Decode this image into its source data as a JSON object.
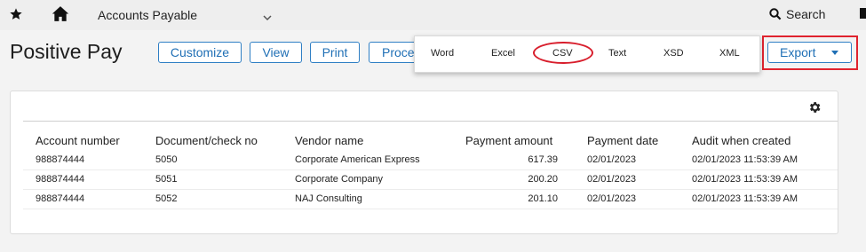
{
  "topbar": {
    "module": "Accounts Payable",
    "search_label": "Search",
    "icons": [
      "star-icon",
      "home-icon",
      "chevron-down-icon",
      "search-icon",
      "flag-icon"
    ]
  },
  "page": {
    "title": "Positive Pay"
  },
  "toolbar": {
    "customize": "Customize",
    "view": "View",
    "print": "Print",
    "process": "Proce",
    "export": "Export"
  },
  "export_menu": {
    "items": [
      "Word",
      "Excel",
      "CSV",
      "Text",
      "XSD",
      "XML"
    ],
    "highlighted": "CSV"
  },
  "table": {
    "columns": [
      "Account number",
      "Document/check no",
      "Vendor name",
      "Payment amount",
      "Payment date",
      "Audit when created"
    ],
    "rows": [
      [
        "988874444",
        "5050",
        "Corporate American Express",
        "617.39",
        "02/01/2023",
        "02/01/2023 11:53:39 AM"
      ],
      [
        "988874444",
        "5051",
        "Corporate Company",
        "200.20",
        "02/01/2023",
        "02/01/2023 11:53:39 AM"
      ],
      [
        "988874444",
        "5052",
        "NAJ Consulting",
        "201.10",
        "02/01/2023",
        "02/01/2023 11:53:39 AM"
      ]
    ]
  },
  "colors": {
    "accent": "#1f6fb5",
    "highlight": "#e0242f"
  }
}
